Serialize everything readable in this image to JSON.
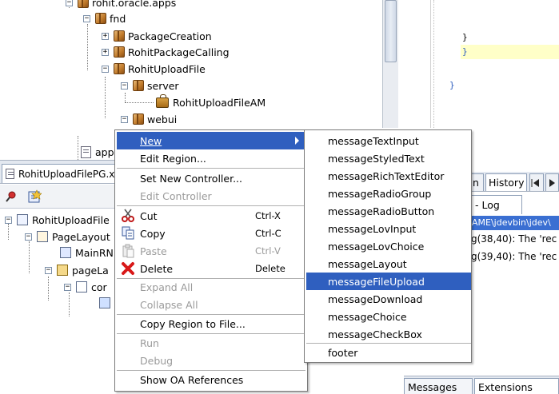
{
  "navigator": {
    "items": [
      {
        "label": "rohit.oracle.apps"
      },
      {
        "label": "fnd"
      },
      {
        "label": "PackageCreation"
      },
      {
        "label": "RohitPackageCalling"
      },
      {
        "label": "RohitUploadFile"
      },
      {
        "label": "server"
      },
      {
        "label": "RohitUploadFileAM"
      },
      {
        "label": "webui"
      },
      {
        "label": "app"
      }
    ]
  },
  "editor": {
    "lines": [
      "}",
      "}",
      "}"
    ]
  },
  "structure": {
    "tab_label": "RohitUploadFilePG.x",
    "tree": [
      {
        "label": "RohitUploadFile"
      },
      {
        "label": "PageLayout"
      },
      {
        "label": "MainRN"
      },
      {
        "label": "pageLa"
      },
      {
        "label": "cor"
      }
    ]
  },
  "right_panes": {
    "tabs": [
      "n",
      "History"
    ],
    "log_tab": "- Log",
    "log_lines": [
      "AME\\jdevbin\\jdev\\",
      "g(38,40): The 'rec",
      "g(39,40): The 'rec"
    ],
    "bottom_tabs": [
      "Messages",
      "Extensions"
    ]
  },
  "context_menu": {
    "items": [
      {
        "label": "New",
        "shortcut": "",
        "disabled": false,
        "highlighted": true
      },
      {
        "label": "Edit Region...",
        "shortcut": "",
        "disabled": false
      },
      {
        "label": "Set New Controller...",
        "shortcut": "",
        "disabled": false
      },
      {
        "label": "Edit Controller",
        "shortcut": "",
        "disabled": true
      },
      {
        "label": "Cut",
        "shortcut": "Ctrl-X",
        "disabled": false
      },
      {
        "label": "Copy",
        "shortcut": "Ctrl-C",
        "disabled": false
      },
      {
        "label": "Paste",
        "shortcut": "Ctrl-V",
        "disabled": true
      },
      {
        "label": "Delete",
        "shortcut": "Delete",
        "disabled": false
      },
      {
        "label": "Expand All",
        "shortcut": "",
        "disabled": true
      },
      {
        "label": "Collapse All",
        "shortcut": "",
        "disabled": true
      },
      {
        "label": "Copy Region to File...",
        "shortcut": "",
        "disabled": false
      },
      {
        "label": "Run",
        "shortcut": "",
        "disabled": true
      },
      {
        "label": "Debug",
        "shortcut": "",
        "disabled": true
      },
      {
        "label": "Show OA References",
        "shortcut": "",
        "disabled": false
      }
    ]
  },
  "submenu": {
    "items": [
      {
        "label": "messageTextInput"
      },
      {
        "label": "messageStyledText"
      },
      {
        "label": "messageRichTextEditor"
      },
      {
        "label": "messageRadioGroup"
      },
      {
        "label": "messageRadioButton"
      },
      {
        "label": "messageLovInput"
      },
      {
        "label": "messageLovChoice"
      },
      {
        "label": "messageLayout"
      },
      {
        "label": "messageFileUpload",
        "highlighted": true
      },
      {
        "label": "messageDownload"
      },
      {
        "label": "messageChoice"
      },
      {
        "label": "messageCheckBox"
      },
      {
        "label": "footer"
      }
    ]
  },
  "colors": {
    "highlight": "#2f5fbf",
    "disabled_text": "#9a9a9a",
    "package_icon": "#c07a2a"
  }
}
